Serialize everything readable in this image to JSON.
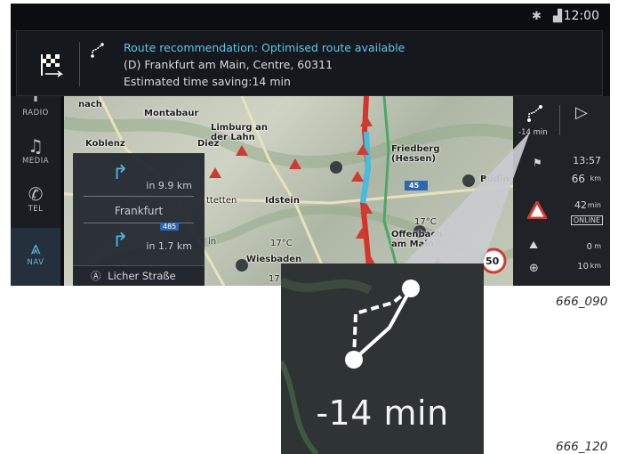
{
  "status": {
    "time": "12:00",
    "icons": [
      "bluetooth-icon",
      "signal-icon"
    ]
  },
  "banner": {
    "title": "Route recommendation: Optimised route available",
    "destination": "(D) Frankfurt am Main, Centre, 60311",
    "saving": "Estimated time saving:14 min"
  },
  "sidebar": {
    "items": [
      {
        "label": "RADIO",
        "icon": "radio-icon"
      },
      {
        "label": "MEDIA",
        "icon": "music-note-icon"
      },
      {
        "label": "TEL",
        "icon": "phone-icon"
      },
      {
        "label": "NAV",
        "icon": "navigation-icon"
      }
    ]
  },
  "maneuvers": {
    "first_distance": "in 9.9 km",
    "city": "Frankfurt",
    "road_badge": "485",
    "second_distance": "in 1.7 km",
    "street": "Licher Straße"
  },
  "map_labels": [
    "nach",
    "Montabaur",
    "Limburg an der Lahn",
    "Koblenz",
    "Diez",
    "Friedberg (Hessen)",
    "Idstein",
    "Büdin",
    "Wiesbaden",
    "17°C",
    "17°C",
    "Offenbach am Main",
    "45",
    "50",
    "ttetten",
    "in",
    "17"
  ],
  "right_panel": {
    "alt_route_time": "-14 min",
    "arrival_time": "13:57",
    "distance_remaining": "66",
    "distance_unit": "km",
    "traffic_delay": "42",
    "traffic_unit": "min",
    "online_label": "ONLINE",
    "elevation": "0",
    "elevation_unit": "m",
    "zoom_scale": "10",
    "zoom_unit": "km"
  },
  "zoom_inset": {
    "label": "-14 min"
  },
  "captions": {
    "top": "666_090",
    "bottom": "666_120"
  },
  "colors": {
    "accent": "#58c9ea",
    "background": "#0d1014",
    "route": "#d8322a"
  }
}
